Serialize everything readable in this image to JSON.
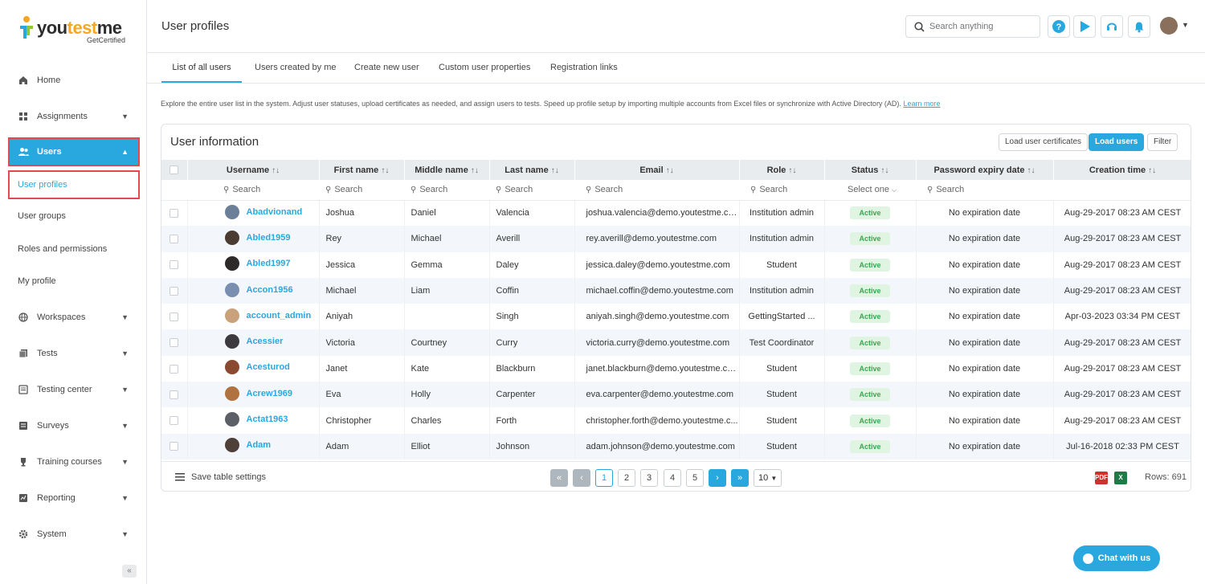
{
  "brand": {
    "name_prefix": "you",
    "name_accent": "test",
    "name_suffix": "me",
    "tagline": "GetCertified"
  },
  "sidebar": {
    "items": [
      {
        "label": "Home",
        "icon": "home-icon"
      },
      {
        "label": "Assignments",
        "icon": "assignments-icon"
      },
      {
        "label": "Users",
        "icon": "users-icon"
      },
      {
        "label": "Workspaces",
        "icon": "globe-icon"
      },
      {
        "label": "Tests",
        "icon": "tests-icon"
      },
      {
        "label": "Testing center",
        "icon": "testing-center-icon"
      },
      {
        "label": "Surveys",
        "icon": "surveys-icon"
      },
      {
        "label": "Training courses",
        "icon": "trophy-icon"
      },
      {
        "label": "Reporting",
        "icon": "reporting-icon"
      },
      {
        "label": "System",
        "icon": "gear-icon"
      }
    ],
    "sub_items": [
      "User profiles",
      "User groups",
      "Roles and permissions",
      "My profile"
    ],
    "collapse_label": "«"
  },
  "header": {
    "title": "User profiles",
    "search_placeholder": "Search anything"
  },
  "tabs": [
    "List of all users",
    "Users created by me",
    "Create new user",
    "Custom user properties",
    "Registration links"
  ],
  "intro": {
    "text": "Explore the entire user list in the system. Adjust user statuses, upload certificates as needed, and assign users to tests. Speed up profile setup by importing multiple accounts from Excel files or synchronize with Active Directory (AD).",
    "link": "Learn more"
  },
  "card": {
    "title": "User information",
    "btn_load_certs": "Load user certificates",
    "btn_load_users": "Load users",
    "btn_filter": "Filter"
  },
  "table": {
    "columns": [
      "Username",
      "First name",
      "Middle name",
      "Last name",
      "Email",
      "Role",
      "Status",
      "Password expiry date",
      "Creation time"
    ],
    "sort_glyph": "↑↓",
    "filter_placeholder": "Search",
    "status_filter": "Select one",
    "rows": [
      {
        "username": "Abadvionand",
        "first": "Joshua",
        "middle": "Daniel",
        "last": "Valencia",
        "email": "joshua.valencia@demo.youtestme.co...",
        "role": "Institution admin",
        "status": "Active",
        "expiry": "No expiration date",
        "created": "Aug-29-2017 08:23 AM CEST",
        "avatar": "#6b7f99"
      },
      {
        "username": "Abled1959",
        "first": "Rey",
        "middle": "Michael",
        "last": "Averill",
        "email": "rey.averill@demo.youtestme.com",
        "role": "Institution admin",
        "status": "Active",
        "expiry": "No expiration date",
        "created": "Aug-29-2017 08:23 AM CEST",
        "avatar": "#4a3b33"
      },
      {
        "username": "Abled1997",
        "first": "Jessica",
        "middle": "Gemma",
        "last": "Daley",
        "email": "jessica.daley@demo.youtestme.com",
        "role": "Student",
        "status": "Active",
        "expiry": "No expiration date",
        "created": "Aug-29-2017 08:23 AM CEST",
        "avatar": "#2f2a2a"
      },
      {
        "username": "Accon1956",
        "first": "Michael",
        "middle": "Liam",
        "last": "Coffin",
        "email": "michael.coffin@demo.youtestme.com",
        "role": "Institution admin",
        "status": "Active",
        "expiry": "No expiration date",
        "created": "Aug-29-2017 08:23 AM CEST",
        "avatar": "#7a8fb0"
      },
      {
        "username": "account_admin",
        "first": "Aniyah",
        "middle": "",
        "last": "Singh",
        "email": "aniyah.singh@demo.youtestme.com",
        "role": "GettingStarted ...",
        "status": "Active",
        "expiry": "No expiration date",
        "created": "Apr-03-2023 03:34 PM CEST",
        "avatar": "#c9a27c"
      },
      {
        "username": "Acessier",
        "first": "Victoria",
        "middle": "Courtney",
        "last": "Curry",
        "email": "victoria.curry@demo.youtestme.com",
        "role": "Test Coordinator",
        "status": "Active",
        "expiry": "No expiration date",
        "created": "Aug-29-2017 08:23 AM CEST",
        "avatar": "#3d3a3f"
      },
      {
        "username": "Acesturod",
        "first": "Janet",
        "middle": "Kate",
        "last": "Blackburn",
        "email": "janet.blackburn@demo.youtestme.co...",
        "role": "Student",
        "status": "Active",
        "expiry": "No expiration date",
        "created": "Aug-29-2017 08:23 AM CEST",
        "avatar": "#8b4a2f"
      },
      {
        "username": "Acrew1969",
        "first": "Eva",
        "middle": "Holly",
        "last": "Carpenter",
        "email": "eva.carpenter@demo.youtestme.com",
        "role": "Student",
        "status": "Active",
        "expiry": "No expiration date",
        "created": "Aug-29-2017 08:23 AM CEST",
        "avatar": "#b0733f"
      },
      {
        "username": "Actat1963",
        "first": "Christopher",
        "middle": "Charles",
        "last": "Forth",
        "email": "christopher.forth@demo.youtestme.c...",
        "role": "Student",
        "status": "Active",
        "expiry": "No expiration date",
        "created": "Aug-29-2017 08:23 AM CEST",
        "avatar": "#5c5f66"
      },
      {
        "username": "Adam",
        "first": "Adam",
        "middle": "Elliot",
        "last": "Johnson",
        "email": "adam.johnson@demo.youtestme.com",
        "role": "Student",
        "status": "Active",
        "expiry": "No expiration date",
        "created": "Jul-16-2018 02:33 PM CEST",
        "avatar": "#4e4038"
      }
    ]
  },
  "footer": {
    "save_settings": "Save table settings",
    "pages": [
      "1",
      "2",
      "3",
      "4",
      "5"
    ],
    "current_page": "1",
    "page_size": "10",
    "rows_label": "Rows: 691",
    "first": "«",
    "prev": "‹",
    "next": "›",
    "last": "»",
    "pdf_label": "PDF",
    "excel_label": "X"
  },
  "chat": {
    "label": "Chat with us"
  },
  "colors": {
    "accent": "#29a8e0",
    "active_badge_bg": "#dff5e1",
    "active_badge_text": "#3aa652",
    "highlight_outline": "#e5484d"
  }
}
